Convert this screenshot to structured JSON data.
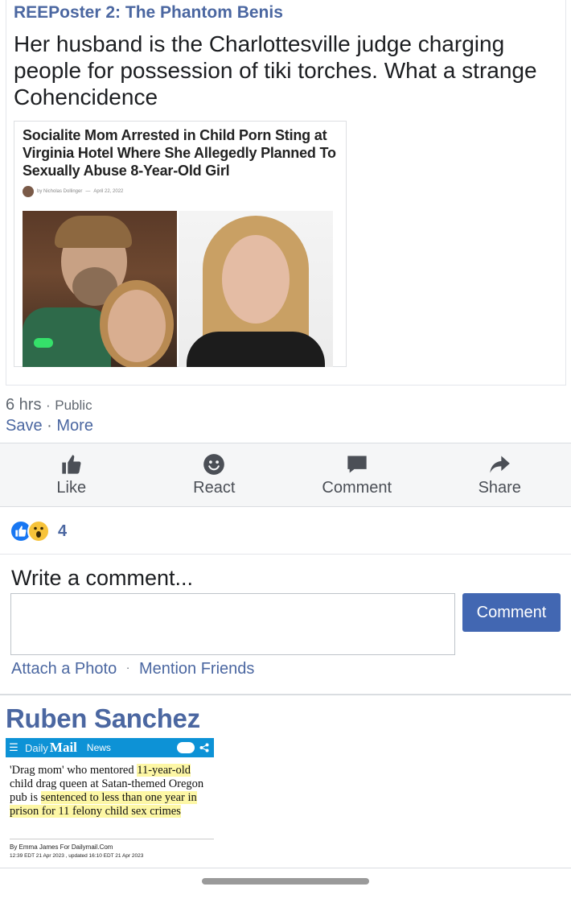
{
  "post": {
    "author": "REEPoster 2: The Phantom Benis",
    "text": "Her husband is the Charlottesville judge charging people for possession of tiki torches. What a strange Cohencidence",
    "link_preview": {
      "headline": "Socialite Mom Arrested in Child Porn Sting at Virginia Hotel Where She Allegedly Planned To Sexually Abuse 8-Year-Old Girl",
      "byline": "by Nicholas Dollinger",
      "date": "April 22, 2022"
    },
    "time": "6 hrs",
    "dot": "·",
    "privacy": "Public",
    "save_label": "Save",
    "more_label": "More"
  },
  "actions": [
    {
      "label": "Like",
      "icon": "thumbs-up-icon"
    },
    {
      "label": "React",
      "icon": "smiley-icon"
    },
    {
      "label": "Comment",
      "icon": "speech-bubble-icon"
    },
    {
      "label": "Share",
      "icon": "share-arrow-icon"
    }
  ],
  "reactions": {
    "types": [
      "like",
      "wow"
    ],
    "count": "4"
  },
  "composer": {
    "label": "Write a comment...",
    "value": "",
    "button": "Comment",
    "attach_photo": "Attach a Photo",
    "sep": "·",
    "mention_friends": "Mention Friends"
  },
  "comment": {
    "author": "Ruben Sanchez",
    "dailymail": {
      "brand_daily": "Daily",
      "brand_mail": "Mail",
      "section": "News",
      "headline_parts": [
        {
          "text": "'Drag mom' who mentored ",
          "highlight": false
        },
        {
          "text": "11-year-old",
          "highlight": true
        },
        {
          "text": " child drag queen at Satan-themed Oregon pub is ",
          "highlight": false
        },
        {
          "text": "sentenced to less than one year in prison for 11 felony child sex crimes",
          "highlight": true
        }
      ],
      "byline": "By Emma James For Dailymail.Com",
      "dateline": "12:39 EDT 21 Apr 2023 , updated 16:10 EDT 21 Apr 2023"
    }
  },
  "colors": {
    "link_blue": "#4b67a1",
    "button_blue": "#4267b2",
    "dm_blue": "#0d92d6",
    "highlight": "#fdf7a5"
  }
}
